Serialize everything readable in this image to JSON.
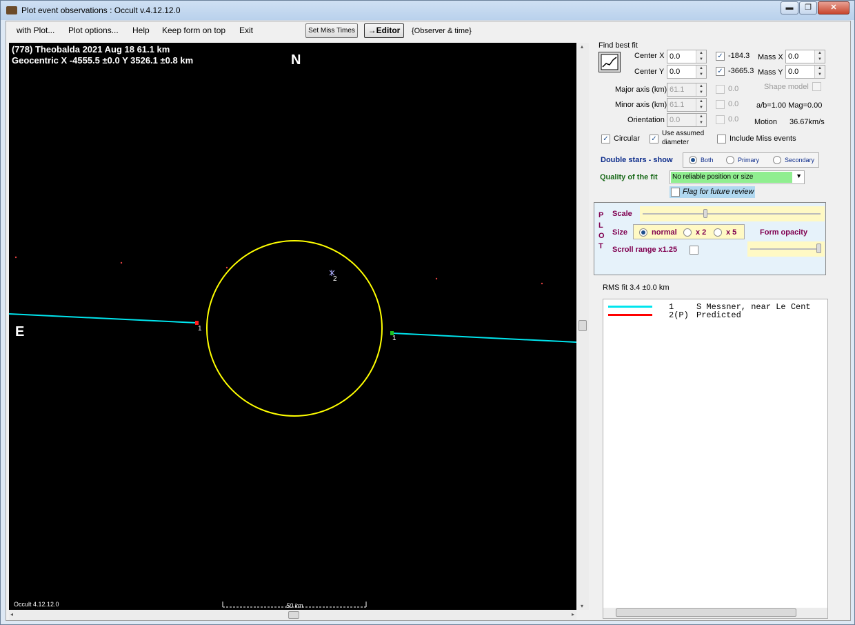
{
  "window": {
    "title": "Plot event observations : Occult v.4.12.12.0",
    "min": "▬",
    "max": "❐",
    "close": "✕"
  },
  "menu": {
    "with_plot": "with Plot...",
    "plot_options": "Plot options...",
    "help": "Help",
    "keep_on_top": "Keep form on top",
    "exit": "Exit",
    "set_miss_times": "Set Miss Times",
    "editor": "→Editor",
    "observer_time": "{Observer & time}"
  },
  "plot": {
    "title_line1": "(778) Theobalda  2021 Aug 18   61.1 km",
    "title_line2": "Geocentric  X  -4555.5 ±0.0  Y 3526.1 ±0.8 km",
    "north": "N",
    "east": "E",
    "version": "Occult 4.12.12.0",
    "scale_label": "50 km",
    "chord_label_left": "1",
    "chord_label_right": "1",
    "star_label": "2",
    "colors": {
      "chord": "#00e5ee",
      "ellipse": "#ffff00",
      "disappear": "#ff2020",
      "reappear": "#20c020",
      "dots": "#e04040"
    }
  },
  "fit": {
    "find_best_fit": "Find best fit",
    "center_x_label": "Center X",
    "center_x": "0.0",
    "center_x_val": "-184.3",
    "center_y_label": "Center Y",
    "center_y": "0.0",
    "center_y_val": "-3665.3",
    "mass_x_label": "Mass X",
    "mass_x": "0.0",
    "mass_y_label": "Mass Y",
    "mass_y": "0.0",
    "major_label": "Major axis (km)",
    "major": "61.1",
    "major_val": "0.0",
    "minor_label": "Minor axis (km)",
    "minor": "61.1",
    "minor_val": "0.0",
    "orient_label": "Orientation",
    "orient": "0.0",
    "orient_val": "0.0",
    "shape_model": "Shape model",
    "ab_mag": "a/b=1.00  Mag=0.00",
    "motion_label": "Motion",
    "motion": "36.67km/s",
    "circular": "Circular",
    "use_assumed_1": "Use assumed",
    "use_assumed_2": "diameter",
    "include_miss": "Include Miss events",
    "double_stars": "Double stars - show",
    "both": "Both",
    "primary": "Primary",
    "secondary": "Secondary",
    "quality_label": "Quality of the fit",
    "quality": "No reliable position or size",
    "flag_review": "Flag for future review"
  },
  "plotbox": {
    "letters": [
      "P",
      "L",
      "O",
      "T"
    ],
    "scale": "Scale",
    "size": "Size",
    "normal": "normal",
    "x2": "x 2",
    "x5": "x 5",
    "form_opacity": "Form opacity",
    "scroll_range": "Scroll range x1.25"
  },
  "rms": "RMS fit 3.4 ±0.0 km",
  "legend": [
    {
      "num": "1",
      "text": "S Messner, near Le Cent",
      "color": "#00e5ee"
    },
    {
      "num": "2(P)",
      "text": "Predicted",
      "color": "#ff0000"
    }
  ]
}
